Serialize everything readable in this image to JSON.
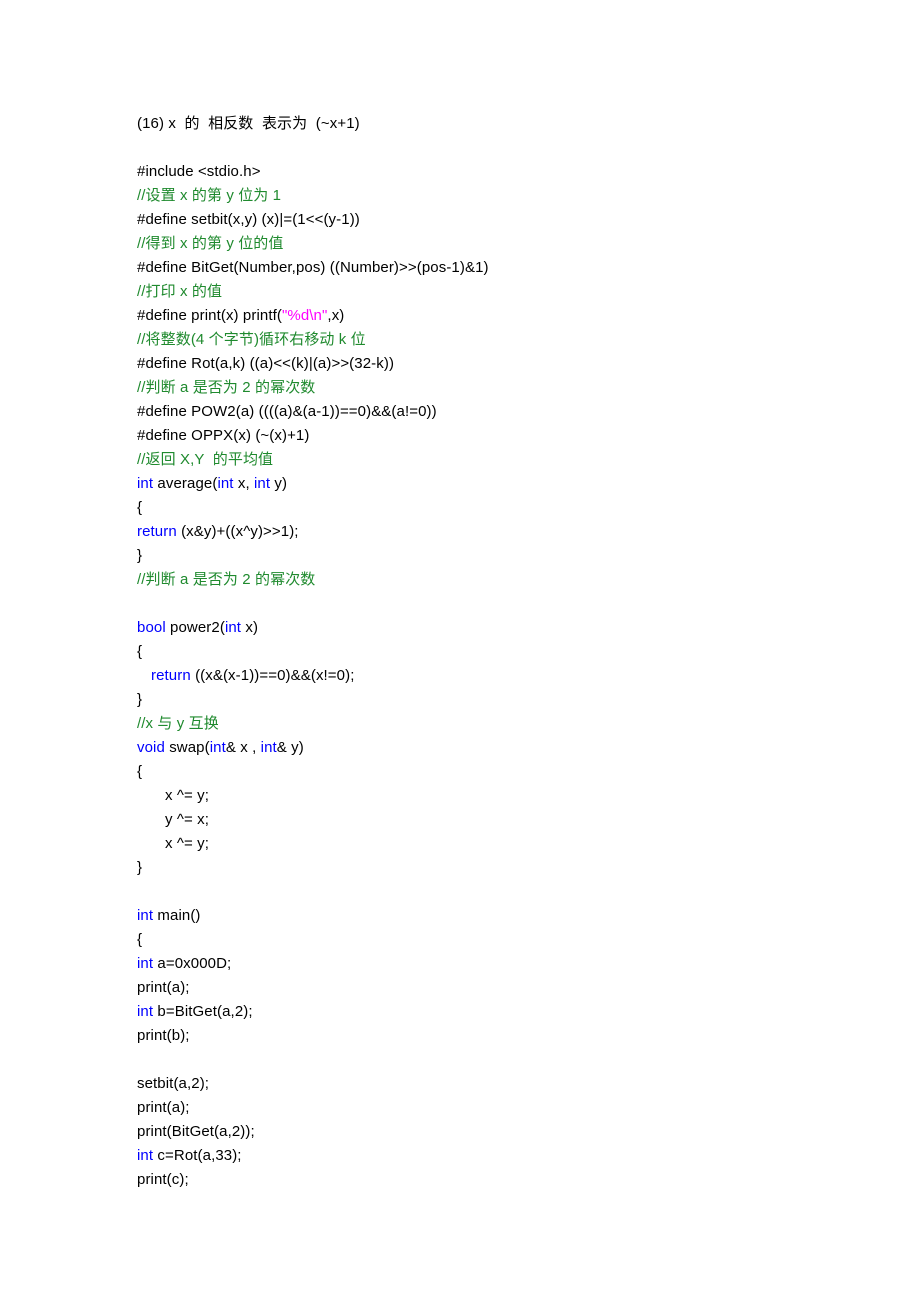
{
  "document": {
    "title_line": "(16) x  的  相反数  表示为  (~x+1)",
    "colors": {
      "text": "#000000",
      "comment": "#1f8a2e",
      "keyword": "#0000ff",
      "string": "#ff00ff",
      "background": "#ffffff"
    },
    "lines": [
      {
        "id": "line-1",
        "indent": 0,
        "tokens": [
          {
            "t": "plain",
            "v": "(16) x  的  相反数  表示为  (~x+1)"
          }
        ]
      },
      {
        "id": "line-2",
        "indent": 0,
        "tokens": [
          {
            "t": "plain",
            "v": ""
          }
        ]
      },
      {
        "id": "line-3",
        "indent": 0,
        "tokens": [
          {
            "t": "plain",
            "v": "#include <stdio.h>"
          }
        ]
      },
      {
        "id": "line-4",
        "indent": 0,
        "tokens": [
          {
            "t": "comment",
            "v": "//设置 x 的第 y 位为 1"
          }
        ]
      },
      {
        "id": "line-5",
        "indent": 0,
        "tokens": [
          {
            "t": "plain",
            "v": "#define setbit(x,y) (x)|=(1<<(y-1))"
          }
        ]
      },
      {
        "id": "line-6",
        "indent": 0,
        "tokens": [
          {
            "t": "comment",
            "v": "//得到 x 的第 y 位的值"
          }
        ]
      },
      {
        "id": "line-7",
        "indent": 0,
        "tokens": [
          {
            "t": "plain",
            "v": "#define BitGet(Number,pos) ((Number)>>(pos-1)&1)"
          }
        ]
      },
      {
        "id": "line-8",
        "indent": 0,
        "tokens": [
          {
            "t": "comment",
            "v": "//打印 x 的值"
          }
        ]
      },
      {
        "id": "line-9",
        "indent": 0,
        "tokens": [
          {
            "t": "plain",
            "v": "#define print(x) printf("
          },
          {
            "t": "string",
            "v": "\"%d\\n\""
          },
          {
            "t": "plain",
            "v": ",x)"
          }
        ]
      },
      {
        "id": "line-10",
        "indent": 0,
        "tokens": [
          {
            "t": "comment",
            "v": "//将整数(4 个字节)循环右移动 k 位"
          }
        ]
      },
      {
        "id": "line-11",
        "indent": 0,
        "tokens": [
          {
            "t": "plain",
            "v": "#define Rot(a,k) ((a)<<(k)|(a)>>(32-k))"
          }
        ]
      },
      {
        "id": "line-12",
        "indent": 0,
        "tokens": [
          {
            "t": "comment",
            "v": "//判断 a 是否为 2 的幂次数"
          }
        ]
      },
      {
        "id": "line-13",
        "indent": 0,
        "tokens": [
          {
            "t": "plain",
            "v": "#define POW2(a) ((((a)&(a-1))==0)&&(a!=0))"
          }
        ]
      },
      {
        "id": "line-14",
        "indent": 0,
        "tokens": [
          {
            "t": "plain",
            "v": "#define OPPX(x) (~(x)+1)"
          }
        ]
      },
      {
        "id": "line-15",
        "indent": 0,
        "tokens": [
          {
            "t": "comment",
            "v": "//返回 X,Y  的平均值"
          }
        ]
      },
      {
        "id": "line-16",
        "indent": 0,
        "tokens": [
          {
            "t": "keyword",
            "v": "int"
          },
          {
            "t": "plain",
            "v": " average("
          },
          {
            "t": "keyword",
            "v": "int"
          },
          {
            "t": "plain",
            "v": " x, "
          },
          {
            "t": "keyword",
            "v": "int"
          },
          {
            "t": "plain",
            "v": " y)"
          }
        ]
      },
      {
        "id": "line-17",
        "indent": 0,
        "tokens": [
          {
            "t": "plain",
            "v": "{"
          }
        ]
      },
      {
        "id": "line-18",
        "indent": 0,
        "tokens": [
          {
            "t": "keyword",
            "v": "return"
          },
          {
            "t": "plain",
            "v": " (x&y)+((x^y)>>1);"
          }
        ]
      },
      {
        "id": "line-19",
        "indent": 0,
        "tokens": [
          {
            "t": "plain",
            "v": "}"
          }
        ]
      },
      {
        "id": "line-20",
        "indent": 0,
        "tokens": [
          {
            "t": "comment",
            "v": "//判断 a 是否为 2 的幂次数"
          }
        ]
      },
      {
        "id": "line-21",
        "indent": 0,
        "tokens": [
          {
            "t": "plain",
            "v": ""
          }
        ]
      },
      {
        "id": "line-22",
        "indent": 0,
        "tokens": [
          {
            "t": "keyword",
            "v": "bool"
          },
          {
            "t": "plain",
            "v": " power2("
          },
          {
            "t": "keyword",
            "v": "int"
          },
          {
            "t": "plain",
            "v": " x)"
          }
        ]
      },
      {
        "id": "line-23",
        "indent": 0,
        "tokens": [
          {
            "t": "plain",
            "v": "{"
          }
        ]
      },
      {
        "id": "line-24",
        "indent": 1,
        "tokens": [
          {
            "t": "keyword",
            "v": "return"
          },
          {
            "t": "plain",
            "v": " ((x&(x-1))==0)&&(x!=0);"
          }
        ]
      },
      {
        "id": "line-25",
        "indent": 0,
        "tokens": [
          {
            "t": "plain",
            "v": "}"
          }
        ]
      },
      {
        "id": "line-26",
        "indent": 0,
        "tokens": [
          {
            "t": "comment",
            "v": "//x 与 y 互换"
          }
        ]
      },
      {
        "id": "line-27",
        "indent": 0,
        "tokens": [
          {
            "t": "keyword",
            "v": "void"
          },
          {
            "t": "plain",
            "v": " swap("
          },
          {
            "t": "keyword",
            "v": "int"
          },
          {
            "t": "plain",
            "v": "& x , "
          },
          {
            "t": "keyword",
            "v": "int"
          },
          {
            "t": "plain",
            "v": "& y)"
          }
        ]
      },
      {
        "id": "line-28",
        "indent": 0,
        "tokens": [
          {
            "t": "plain",
            "v": "{"
          }
        ]
      },
      {
        "id": "line-29",
        "indent": 2,
        "tokens": [
          {
            "t": "plain",
            "v": "x ^= y;"
          }
        ]
      },
      {
        "id": "line-30",
        "indent": 2,
        "tokens": [
          {
            "t": "plain",
            "v": "y ^= x;"
          }
        ]
      },
      {
        "id": "line-31",
        "indent": 2,
        "tokens": [
          {
            "t": "plain",
            "v": "x ^= y;"
          }
        ]
      },
      {
        "id": "line-32",
        "indent": 0,
        "tokens": [
          {
            "t": "plain",
            "v": "}"
          }
        ]
      },
      {
        "id": "line-33",
        "indent": 0,
        "tokens": [
          {
            "t": "plain",
            "v": ""
          }
        ]
      },
      {
        "id": "line-34",
        "indent": 0,
        "tokens": [
          {
            "t": "keyword",
            "v": "int"
          },
          {
            "t": "plain",
            "v": " main()"
          }
        ]
      },
      {
        "id": "line-35",
        "indent": 0,
        "tokens": [
          {
            "t": "plain",
            "v": "{"
          }
        ]
      },
      {
        "id": "line-36",
        "indent": 0,
        "tokens": [
          {
            "t": "keyword",
            "v": "int"
          },
          {
            "t": "plain",
            "v": " a=0x000D;"
          }
        ]
      },
      {
        "id": "line-37",
        "indent": 0,
        "tokens": [
          {
            "t": "plain",
            "v": "print(a);"
          }
        ]
      },
      {
        "id": "line-38",
        "indent": 0,
        "tokens": [
          {
            "t": "keyword",
            "v": "int"
          },
          {
            "t": "plain",
            "v": " b=BitGet(a,2);"
          }
        ]
      },
      {
        "id": "line-39",
        "indent": 0,
        "tokens": [
          {
            "t": "plain",
            "v": "print(b);"
          }
        ]
      },
      {
        "id": "line-40",
        "indent": 0,
        "tokens": [
          {
            "t": "plain",
            "v": ""
          }
        ]
      },
      {
        "id": "line-41",
        "indent": 0,
        "tokens": [
          {
            "t": "plain",
            "v": "setbit(a,2);"
          }
        ]
      },
      {
        "id": "line-42",
        "indent": 0,
        "tokens": [
          {
            "t": "plain",
            "v": "print(a);"
          }
        ]
      },
      {
        "id": "line-43",
        "indent": 0,
        "tokens": [
          {
            "t": "plain",
            "v": "print(BitGet(a,2));"
          }
        ]
      },
      {
        "id": "line-44",
        "indent": 0,
        "tokens": [
          {
            "t": "keyword",
            "v": "int"
          },
          {
            "t": "plain",
            "v": " c=Rot(a,33);"
          }
        ]
      },
      {
        "id": "line-45",
        "indent": 0,
        "tokens": [
          {
            "t": "plain",
            "v": "print(c);"
          }
        ]
      }
    ]
  }
}
